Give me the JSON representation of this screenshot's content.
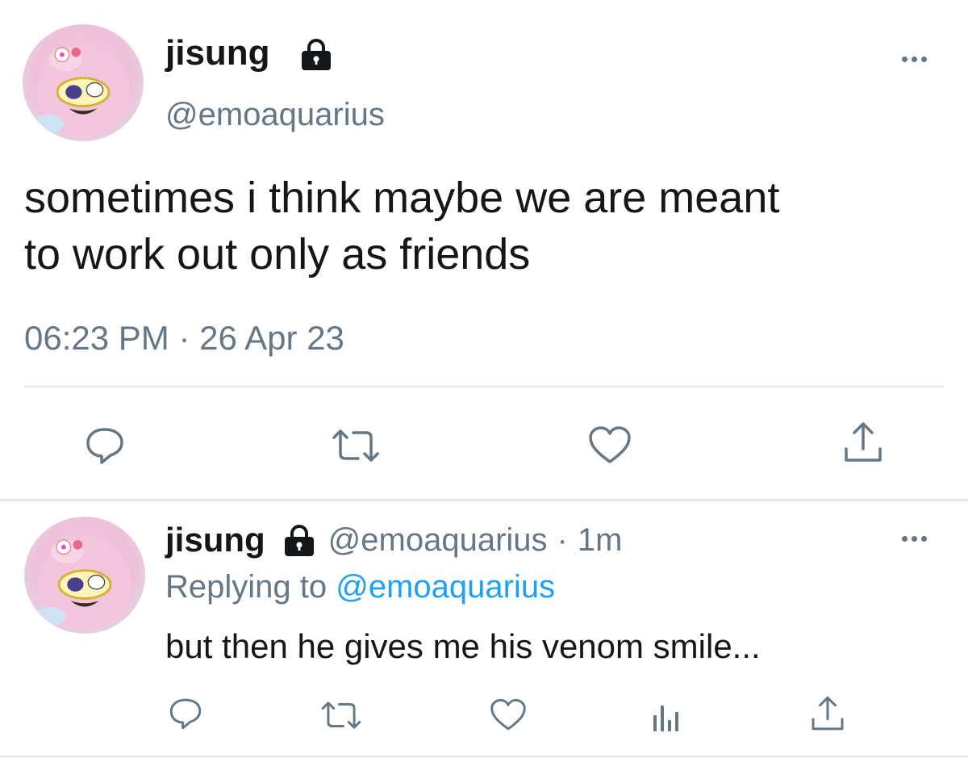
{
  "main_tweet": {
    "display_name": "jisung",
    "handle": "@emoaquarius",
    "text_line1": "sometimes i think maybe we are meant",
    "text_line2": "to work out only as friends",
    "timestamp": "06:23 PM · 26 Apr 23",
    "avatar_icon": "pink-character-avatar",
    "lock_icon": "lock-icon",
    "actions": [
      "reply-icon",
      "retweet-icon",
      "like-icon",
      "share-icon"
    ]
  },
  "reply_tweet": {
    "display_name": "jisung",
    "handle": "@emoaquarius",
    "separator": "·",
    "time_ago": "1m",
    "replying_prefix": "Replying to",
    "replying_handle": "@emoaquarius",
    "text": "but then he gives me his venom smile...",
    "actions": [
      "reply-icon",
      "retweet-icon",
      "like-icon",
      "analytics-icon",
      "share-icon"
    ]
  },
  "colors": {
    "text": "#14171a",
    "muted": "#657786",
    "link": "#1da1f2",
    "divider": "#e1e8ed"
  }
}
